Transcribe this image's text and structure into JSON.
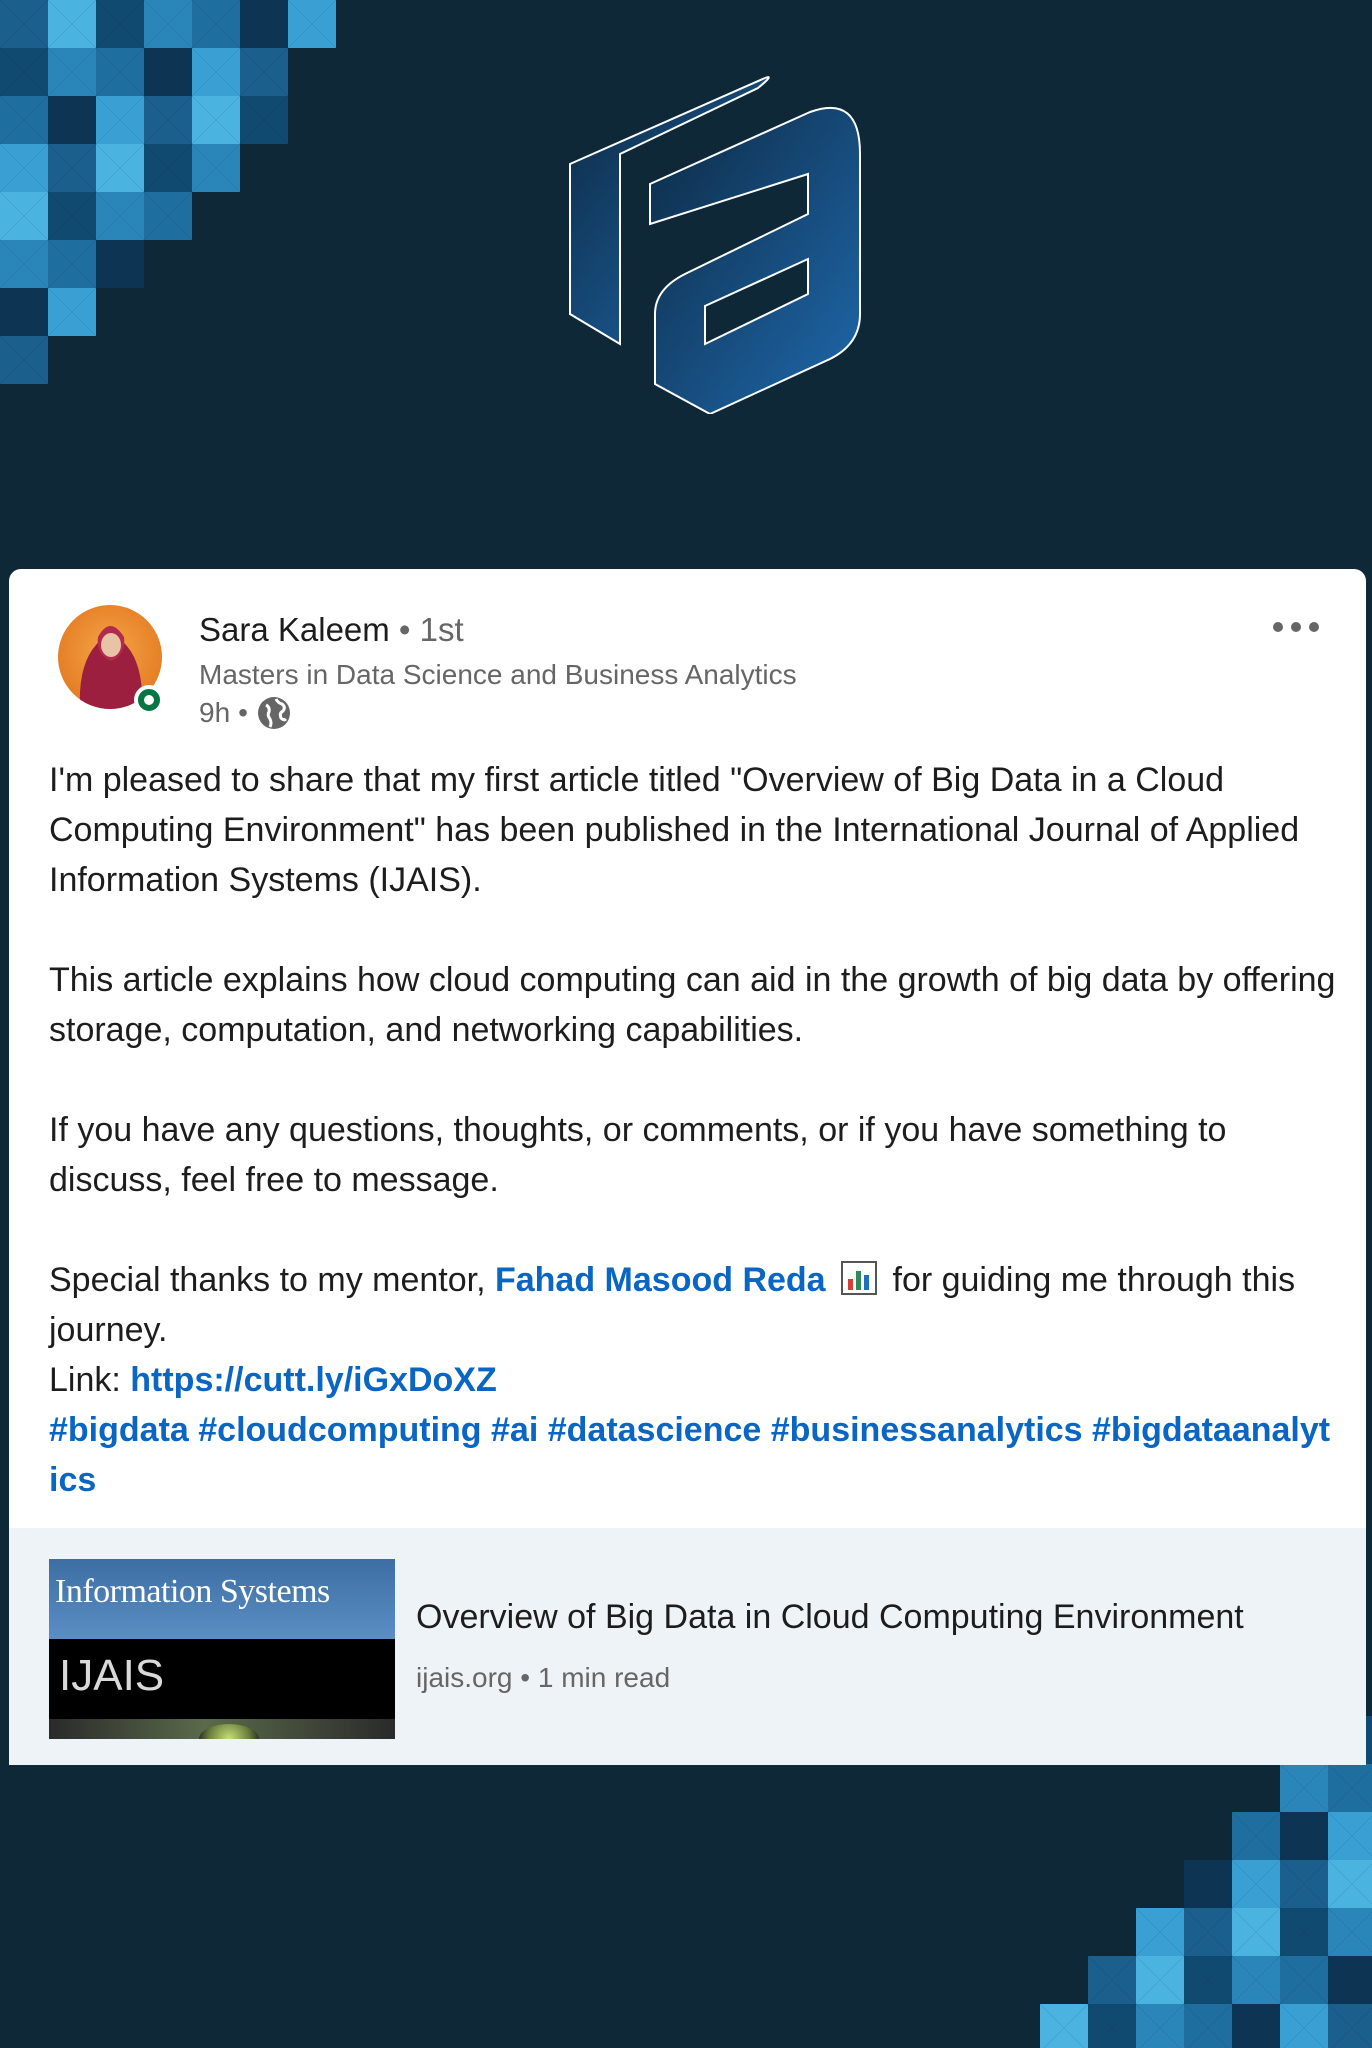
{
  "colors": {
    "background": "#0f2837",
    "card": "#ffffff",
    "link": "#0a66c2",
    "presence": "#057642",
    "preview_bg": "#eef3f8"
  },
  "icons": {
    "logo": "fa-logo-icon",
    "more": "more-horizontal-icon",
    "visibility": "globe-icon",
    "emoji": "bar-chart-emoji-icon"
  },
  "post": {
    "author": {
      "name": "Sara Kaleem",
      "separator": " • ",
      "degree": "1st",
      "headline": "Masters in Data Science and Business Analytics",
      "time": "9h",
      "time_separator": "•"
    },
    "paragraph1": "I'm pleased to share that my first article titled \"Overview of Big Data in a Cloud Computing Environment\" has been published in the International Journal of Applied Information Systems (IJAIS).",
    "paragraph2": "This article explains how cloud computing can aid in the growth of big data by offering storage, computation, and networking capabilities.",
    "paragraph3": "If you have any questions, thoughts, or comments, or if you have something to discuss, feel free to message.",
    "thanks_prefix": "Special thanks to my mentor, ",
    "mentor": "Fahad Masood Reda",
    "thanks_suffix": " for guiding me through this journey.",
    "link_label": "Link: ",
    "link_url": "https://cutt.ly/iGxDoXZ",
    "hashtags": "#bigdata #cloudcomputing #ai #datascience #businessanalytics #bigdataanalytics"
  },
  "article": {
    "thumb_title": "Information Systems",
    "thumb_code": "IJAIS",
    "title": "Overview of Big Data in Cloud Computing Environment",
    "source": "ijais.org",
    "separator": " • ",
    "read_time": "1 min read"
  }
}
